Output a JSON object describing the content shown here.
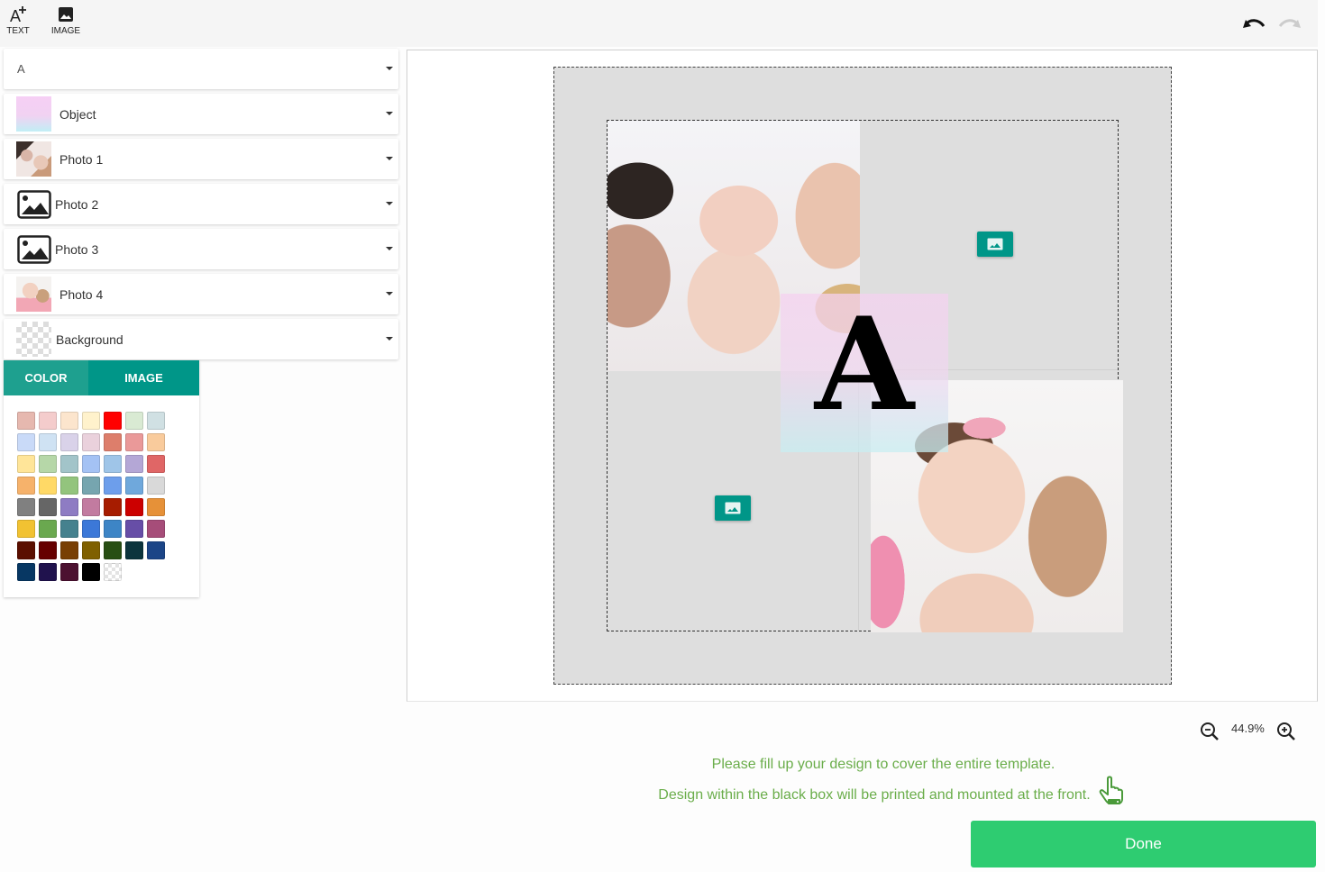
{
  "toolbar": {
    "tools": [
      {
        "label": "TEXT",
        "icon": "add-text-icon"
      },
      {
        "label": "IMAGE",
        "icon": "image-icon"
      }
    ],
    "undo_icon": "undo-icon",
    "redo_icon": "redo-icon"
  },
  "layers": [
    {
      "name": "A",
      "type": "text"
    },
    {
      "name": "Object",
      "type": "object"
    },
    {
      "name": "Photo 1",
      "type": "photo"
    },
    {
      "name": "Photo 2",
      "type": "placeholder"
    },
    {
      "name": "Photo 3",
      "type": "placeholder"
    },
    {
      "name": "Photo 4",
      "type": "photo"
    },
    {
      "name": "Background",
      "type": "background"
    }
  ],
  "background_panel": {
    "tabs": [
      {
        "label": "COLOR",
        "active": true
      },
      {
        "label": "IMAGE",
        "active": false
      }
    ],
    "swatches": [
      "#e6b8af",
      "#f4cccc",
      "#fce5cd",
      "#fff2cc",
      "#ff0000",
      "#d9ead3",
      "#d0e0e3",
      "#c9daf8",
      "#cfe2f3",
      "#d9d2e9",
      "#ead1dc",
      "#dd7e6b",
      "#ea9999",
      "#f9cb9c",
      "#ffe599",
      "#b6d7a8",
      "#a2c4c9",
      "#a4c2f4",
      "#9fc5e8",
      "#b4a7d6",
      "#e06666",
      "#f6b26b",
      "#ffd966",
      "#93c47d",
      "#76a5af",
      "#6d9eeb",
      "#6fa8dc",
      "#d9d9d9",
      "#808080",
      "#666666",
      "#8e7cc3",
      "#c27ba0",
      "#a61c00",
      "#cc0000",
      "#e69138",
      "#f1c232",
      "#6aa84f",
      "#45818e",
      "#3c78d8",
      "#3d85c6",
      "#674ea7",
      "#a64d79",
      "#5b0f00",
      "#660000",
      "#783f04",
      "#7f6000",
      "#274e13",
      "#0c343d",
      "#1c4587",
      "#073763",
      "#20124d",
      "#4c1130",
      "#000000",
      "transparent"
    ]
  },
  "canvas": {
    "text_element": "A",
    "placeholders": [
      {
        "name": "Photo 2",
        "icon": "add-image-icon"
      },
      {
        "name": "Photo 3",
        "icon": "add-image-icon"
      }
    ]
  },
  "zoom": {
    "value": "44.9%"
  },
  "messages": {
    "line1": "Please fill up your design to cover the entire template.",
    "line2": "Design within the black box will be printed and mounted at the front."
  },
  "done_button": {
    "label": "Done"
  },
  "colors": {
    "accent": "#009688",
    "done": "#2ecc71",
    "message": "#6aad4a"
  }
}
